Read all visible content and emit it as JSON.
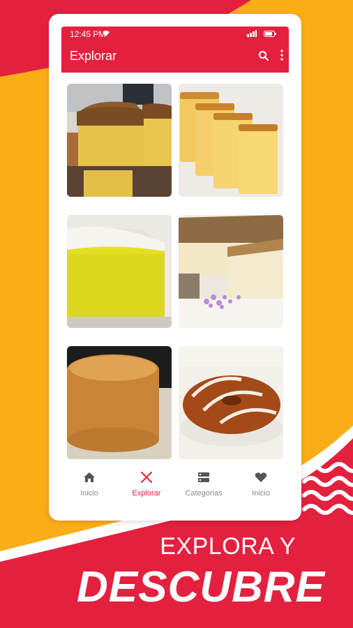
{
  "status_bar": {
    "time": "12:45 PM"
  },
  "appbar": {
    "title": "Explorar"
  },
  "grid": {
    "items": [
      {
        "alt": "sponge-cake-slices"
      },
      {
        "alt": "pound-cake-slices"
      },
      {
        "alt": "yellow-sugar-cake"
      },
      {
        "alt": "cheesecake-slice"
      },
      {
        "alt": "round-sponge-cake"
      },
      {
        "alt": "swirl-bundt-cake"
      }
    ]
  },
  "bottom_nav": {
    "items": [
      {
        "label": "Inicio",
        "icon": "home-icon"
      },
      {
        "label": "Explorar",
        "icon": "utensils-icon"
      },
      {
        "label": "Categorias",
        "icon": "categories-icon"
      },
      {
        "label": "Inicio",
        "icon": "heart-icon"
      }
    ]
  },
  "promo": {
    "line1": "EXPLORA Y",
    "line2": "DESCUBRE"
  },
  "colors": {
    "accent": "#e3213f",
    "background": "#fbad18"
  }
}
